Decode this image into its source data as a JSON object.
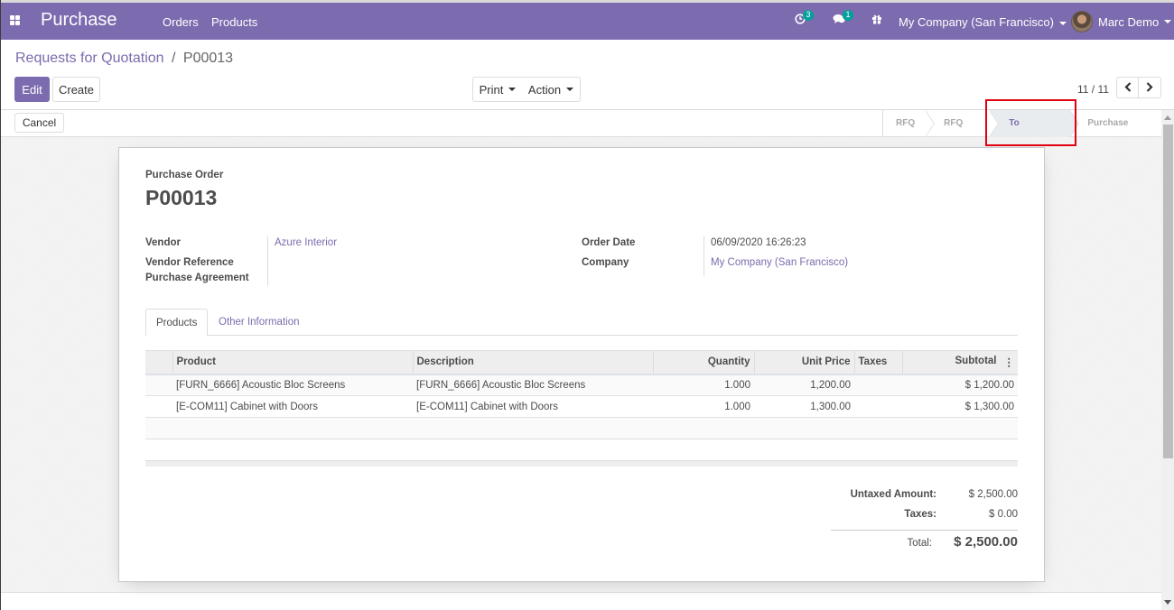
{
  "navbar": {
    "app_name": "Purchase",
    "menu": [
      "Orders",
      "Products"
    ],
    "activity_count": "3",
    "messages_count": "1",
    "company": "My Company (San Francisco)",
    "user": "Marc Demo",
    "brand_color": "#7c6bae"
  },
  "breadcrumb": {
    "parent": "Requests for Quotation",
    "separator": "/",
    "current": "P00013"
  },
  "toolbar": {
    "edit_label": "Edit",
    "create_label": "Create",
    "print_label": "Print",
    "action_label": "Action",
    "pager": "11 / 11"
  },
  "statusbar": {
    "cancel_label": "Cancel",
    "steps": [
      "RFQ",
      "RFQ Sent",
      "To Approve",
      "Purchase Order"
    ],
    "active_step": "To Approve"
  },
  "form": {
    "doc_type": "Purchase Order",
    "name": "P00013",
    "left_fields": [
      {
        "label": "Vendor",
        "value": "Azure Interior"
      },
      {
        "label": "Vendor Reference",
        "value": ""
      },
      {
        "label": "Purchase Agreement",
        "value": ""
      }
    ],
    "right_fields": [
      {
        "label": "Order Date",
        "value": "06/09/2020 16:26:23"
      },
      {
        "label": "Company",
        "value": "My Company (San Francisco)"
      }
    ],
    "tabs": [
      "Products",
      "Other Information"
    ],
    "columns": [
      "Product",
      "Description",
      "Quantity",
      "Unit Price",
      "Taxes",
      "Subtotal"
    ],
    "lines": [
      {
        "product": "[FURN_6666] Acoustic Bloc Screens",
        "description": "[FURN_6666] Acoustic Bloc Screens",
        "quantity": "1.000",
        "unit_price": "1,200.00",
        "taxes": "",
        "subtotal": "$ 1,200.00"
      },
      {
        "product": "[E-COM11] Cabinet with Doors",
        "description": "[E-COM11] Cabinet with Doors",
        "quantity": "1.000",
        "unit_price": "1,300.00",
        "taxes": "",
        "subtotal": "$ 1,300.00"
      }
    ],
    "totals": {
      "untaxed_label": "Untaxed Amount:",
      "untaxed_value": "$ 2,500.00",
      "taxes_label": "Taxes:",
      "taxes_value": "$ 0.00",
      "total_label": "Total:",
      "total_value": "$ 2,500.00"
    }
  }
}
